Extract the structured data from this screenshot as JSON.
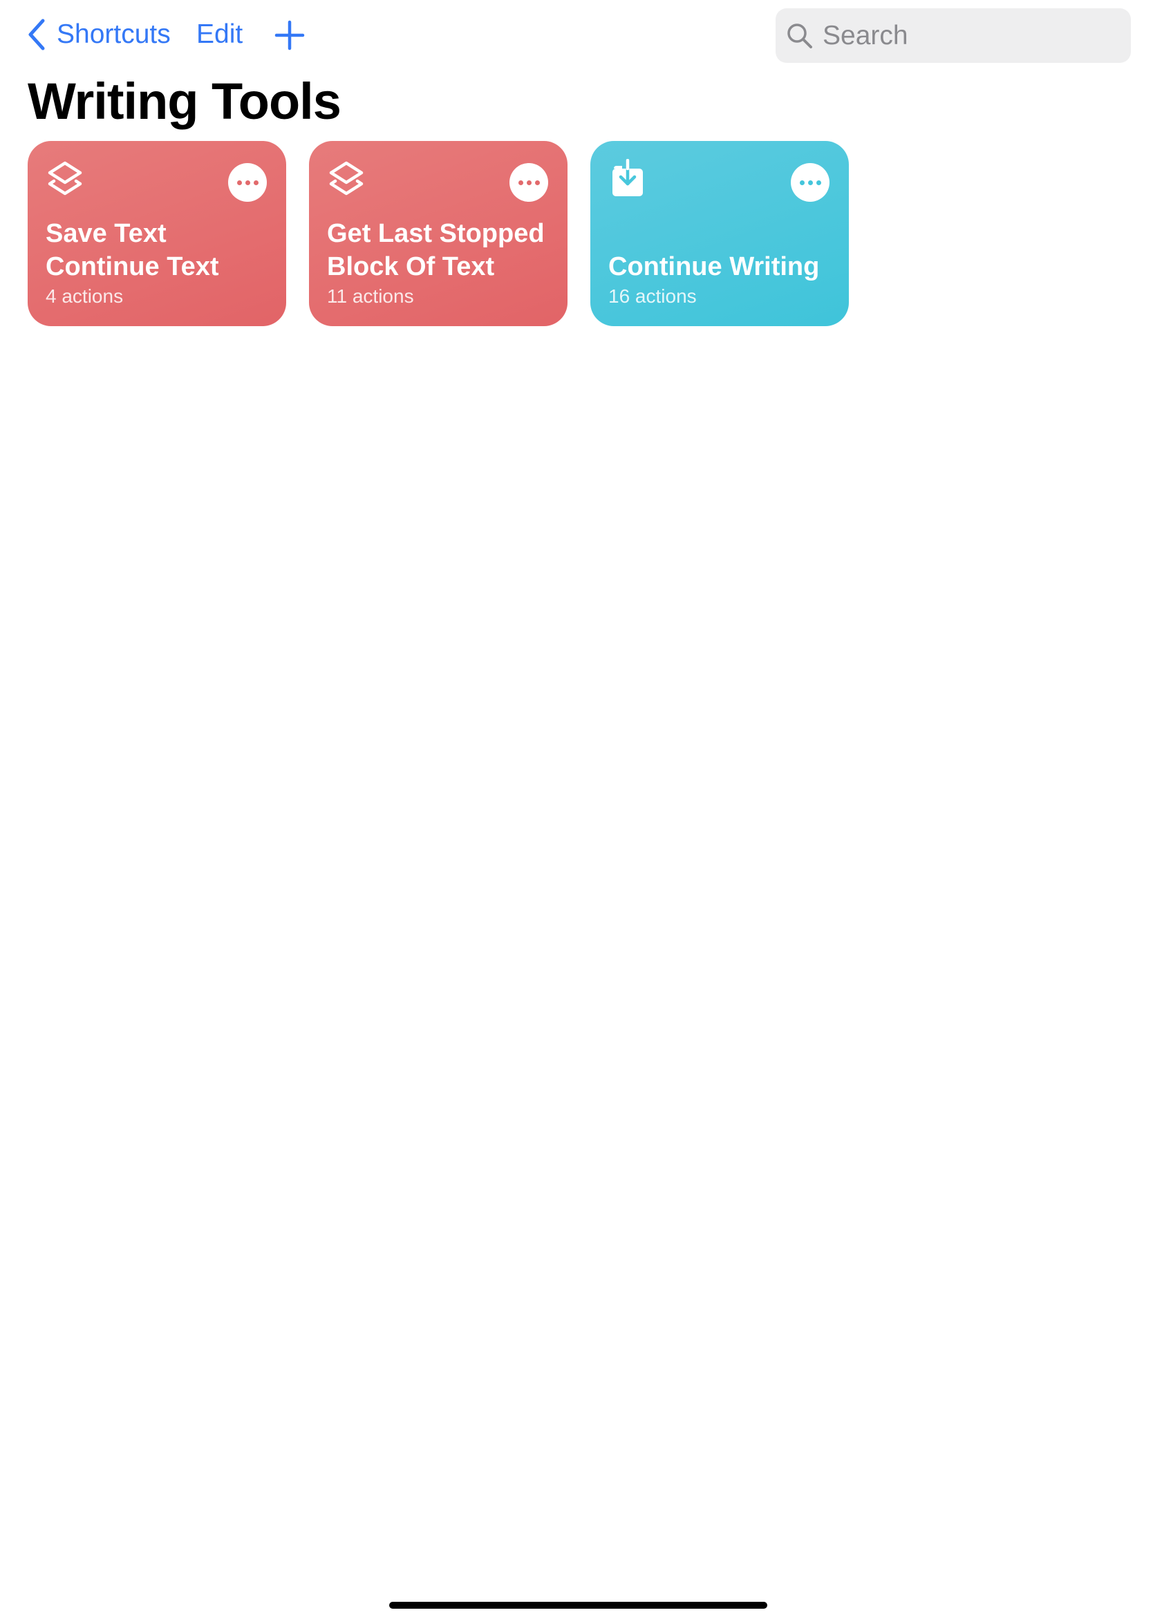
{
  "nav": {
    "back_label": "Shortcuts",
    "edit_label": "Edit",
    "add_icon": "plus-icon",
    "search_placeholder": "Search",
    "search_value": ""
  },
  "page_title": "Writing Tools",
  "shortcuts": [
    {
      "title": "Save Text\nContinue Text",
      "count": "4 actions",
      "icon": "layers-icon",
      "color": "#e36a6c"
    },
    {
      "title": "Get Last Stopped\nBlock Of Text",
      "count": "11 actions",
      "icon": "layers-icon",
      "color": "#e36a6c"
    },
    {
      "title": "Continue Writing",
      "count": "16 actions",
      "icon": "download-tray-icon",
      "color": "#45c6db"
    }
  ],
  "colors": {
    "accent": "#3478f6",
    "red_card": "#e36a6c",
    "cyan_card": "#45c6db"
  }
}
